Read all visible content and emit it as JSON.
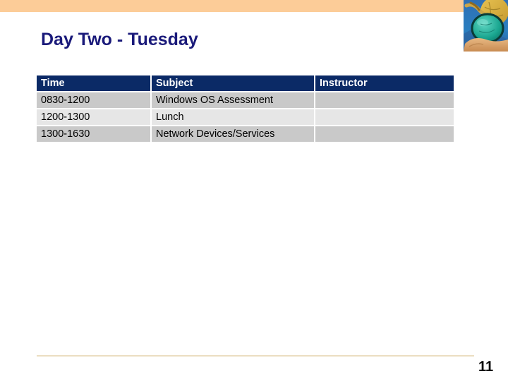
{
  "slide": {
    "title": "Day Two - Tuesday",
    "page_number": "11",
    "accent_orange": "#fccc98",
    "title_color": "#1a1a7a",
    "header_navy": "#0b2a66",
    "row_shade": "#c9c9c9",
    "row_light": "#e6e6e6",
    "rule_color": "#c9a352"
  },
  "decor": {
    "banner_name": "orange-top-banner",
    "photo_name": "magnifying-glass-globe-photo"
  },
  "table": {
    "headers": [
      "Time",
      "Subject",
      "Instructor"
    ],
    "rows": [
      {
        "time": "0830-1200",
        "subject": "Windows OS Assessment",
        "instructor": ""
      },
      {
        "time": "1200-1300",
        "subject": "Lunch",
        "instructor": ""
      },
      {
        "time": "1300-1630",
        "subject": "Network Devices/Services",
        "instructor": ""
      }
    ]
  }
}
